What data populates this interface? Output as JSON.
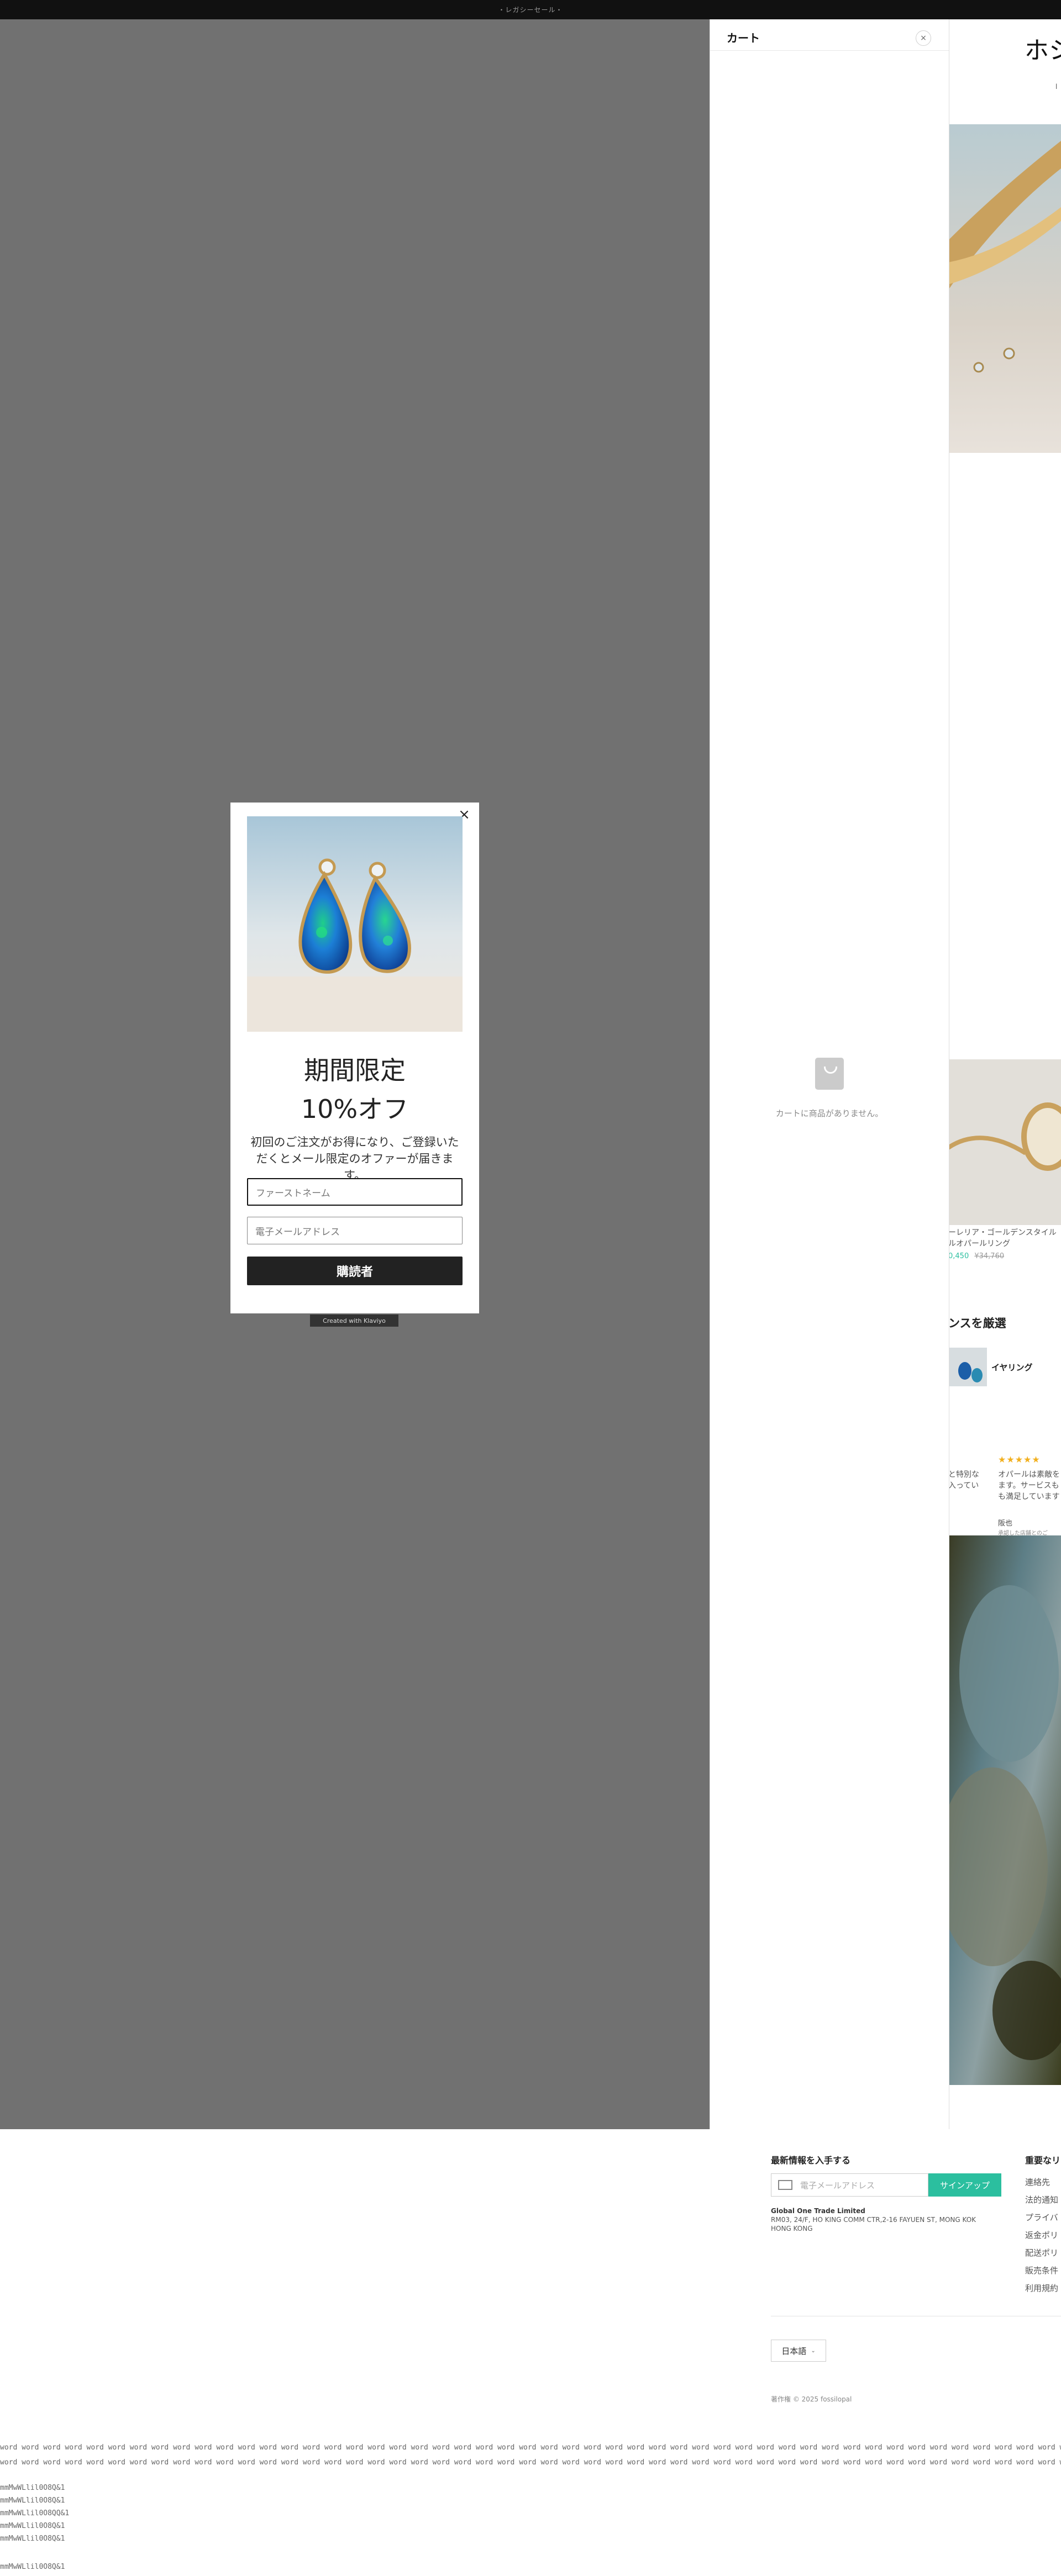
{
  "announcement": "・レガシーセール・",
  "background_page": {
    "heading": "ホシ",
    "product_name_1": "ーレリア・ゴールデンスタイル",
    "product_name_2": "ルオパールリング",
    "price_sale": "0,450",
    "price_orig": "¥34,760",
    "section_title": "ンスを厳選",
    "category_label": "イヤリング",
    "review_stars": "★★★★★",
    "review_left_1": "と特別な",
    "review_left_2": "入ってい",
    "review_right_1": "オパールは素敵を",
    "review_right_2": "ます。サービスも",
    "review_right_3": "も満足しています",
    "review_author": "阪也",
    "review_meta": "承認した店舗とのご"
  },
  "cart": {
    "title": "カート",
    "close_label": "×",
    "empty_text": "カートに商品がありません。"
  },
  "popup": {
    "close_label": "×",
    "title_line1": "期間限定",
    "title_line2": "10%オフ",
    "description": "初回のご注文がお得になり、ご登録いただくとメール限定のオファーが届きます。",
    "first_name_placeholder": "ファーストネーム",
    "email_placeholder": "電子メールアドレス",
    "submit_label": "購読者",
    "created_with": "Created with  Klaviyo"
  },
  "footer": {
    "newsletter_title": "最新情報を入手する",
    "email_placeholder": "電子メールアドレス",
    "signup_label": "サインアップ",
    "company_name": "Global One Trade Limited",
    "company_address": "RM03, 24/F, HO KING COMM CTR,2-16 FAYUEN ST, MONG KOK HONG KONG",
    "links_title": "重要なリ",
    "links": [
      "連絡先",
      "法的通知",
      "プライバ",
      "返金ポリ",
      "配送ポリ",
      "販売条件",
      "利用規約"
    ],
    "language": "日本語",
    "copyright": "著作権 © 2025 fossilopal"
  },
  "debug_lines": [
    "word word word word word word word word word word word word word word word word word word word word word word word word word word word word word word word word word word word word word word word word word word word word word word word word word word word word word word word word word word word word word word word word word word word word",
    "word word word word word word word word word word word word word word word word word word word word word word word word word word word word word word word word word word word word word word word word word word word word word word word word word word word word word word word word word word word word word word word word word word word word",
    "mmMwWLlil0O8Q&1",
    "mmMwWLlil0O8Q&1",
    "mmMwWLlil0O8QQ&1",
    "mmMwWLlil0O8Q&1",
    "mmMwWLlil0O8Q&1",
    "mmMwWLlil0O8Q&1",
    "mmMwWLlil0O8Q&1"
  ],
  "colors": {
    "overlay": "#717171",
    "accent": "#2bbf9f",
    "sale_price": "#2bbf9f"
  }
}
